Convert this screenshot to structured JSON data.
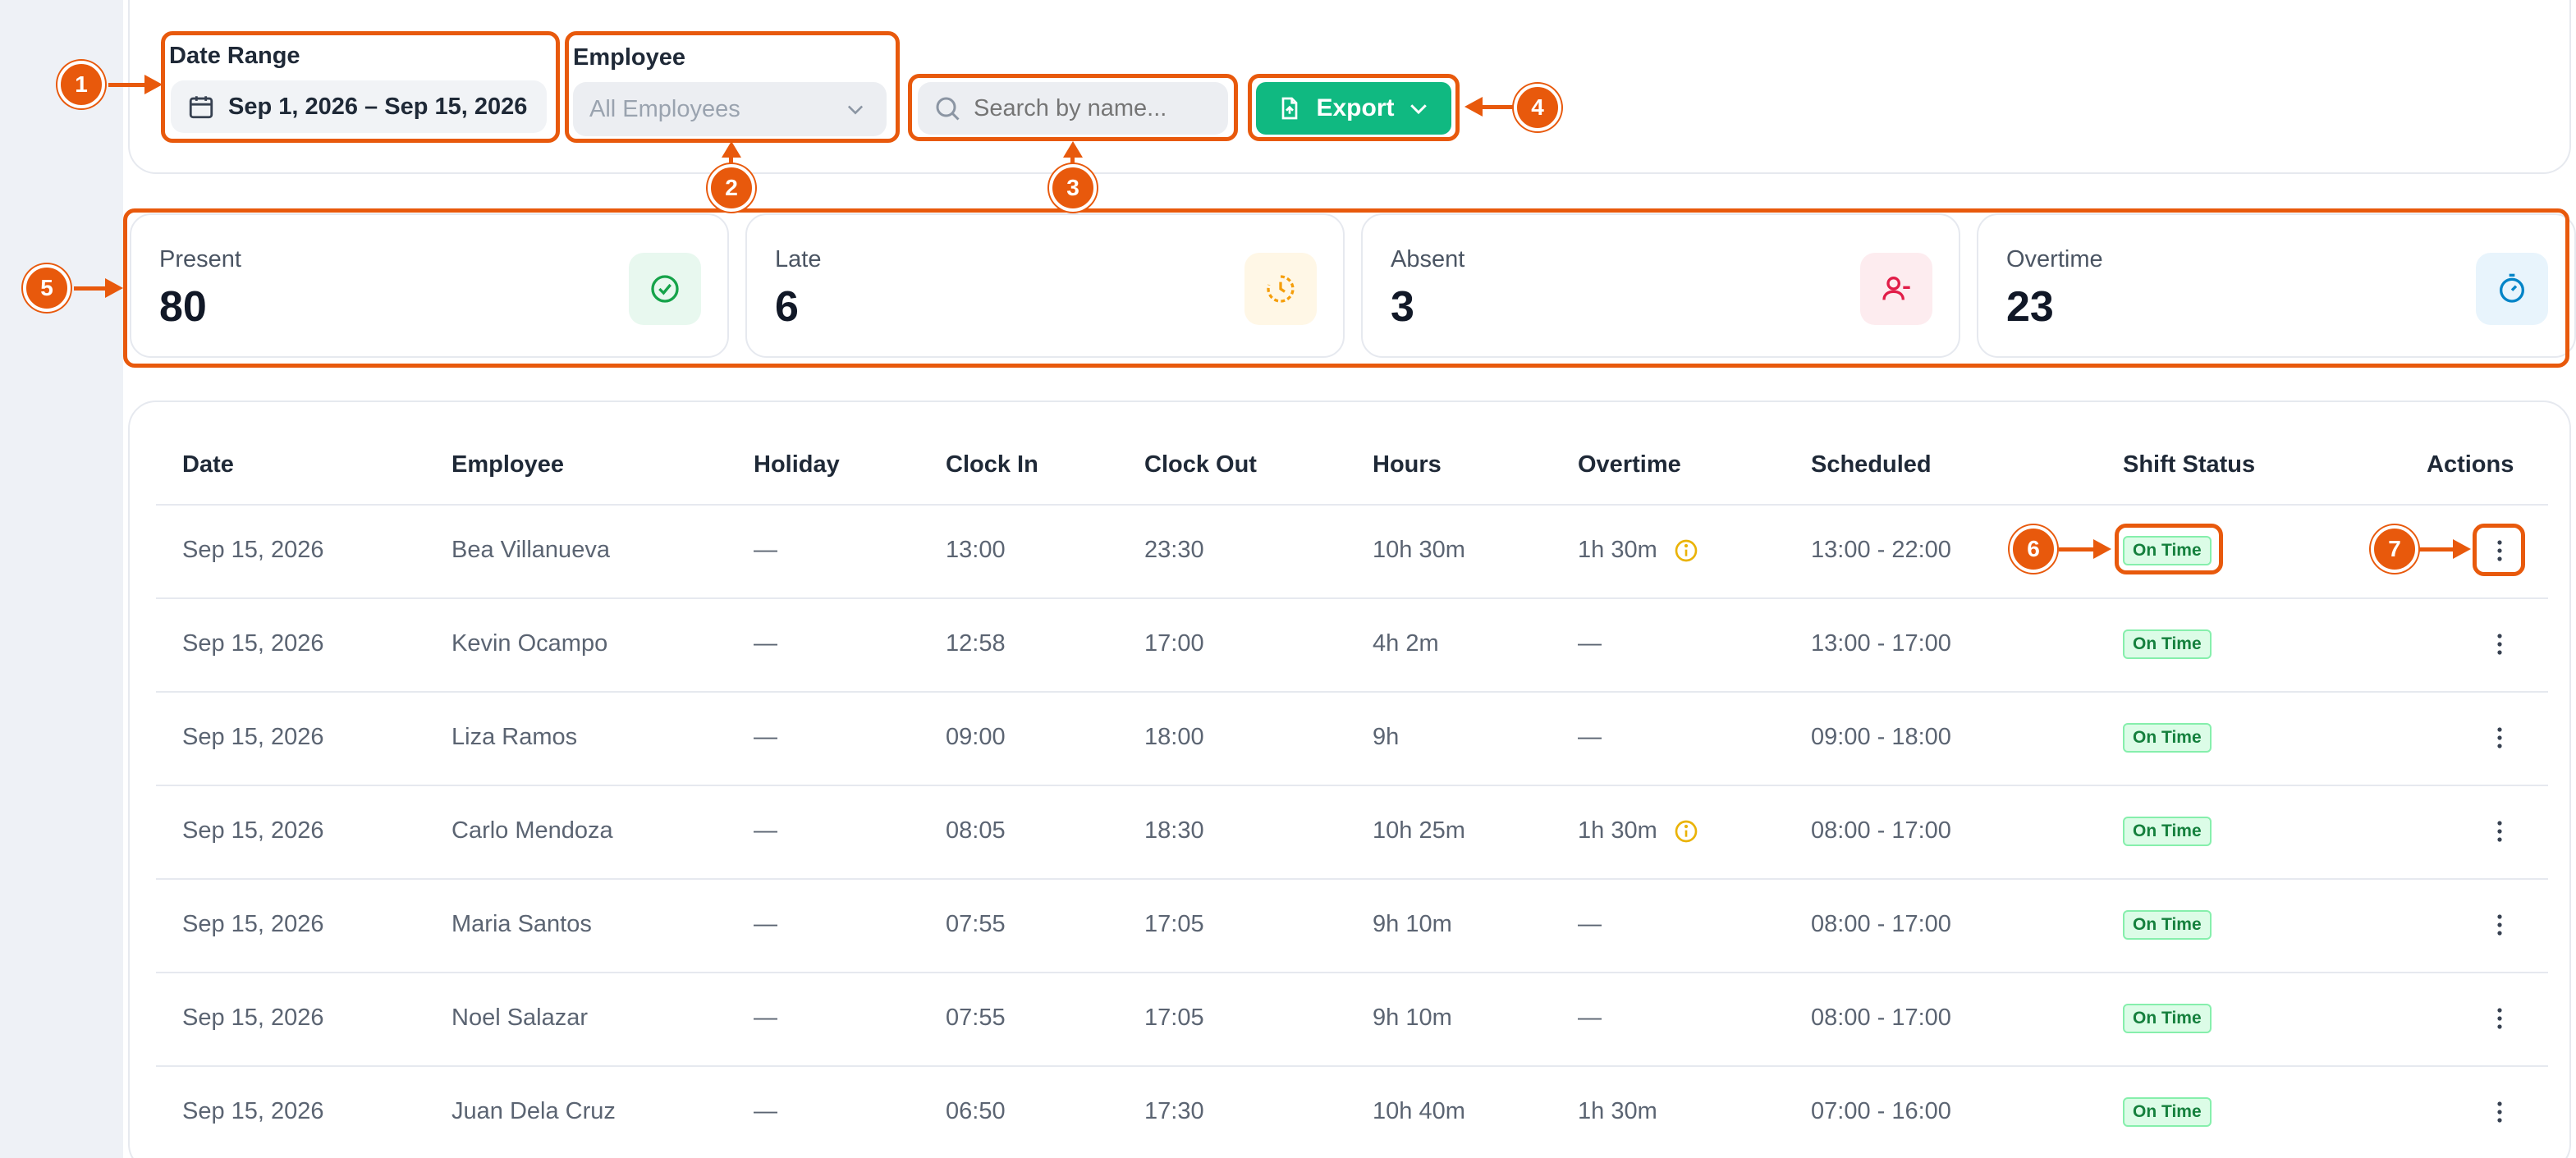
{
  "filters": {
    "date_range_label": "Date Range",
    "date_range_value": "Sep 1, 2026 – Sep 15, 2026",
    "employee_label": "Employee",
    "employee_placeholder": "All Employees",
    "search_placeholder": "Search by name...",
    "export_label": "Export"
  },
  "stats": [
    {
      "label": "Present",
      "value": "80",
      "icon": "check-circle-icon",
      "bg": "#e8f8ef",
      "fg": "#16a34a"
    },
    {
      "label": "Late",
      "value": "6",
      "icon": "clock-late-icon",
      "bg": "#fff7e6",
      "fg": "#f59e0b"
    },
    {
      "label": "Absent",
      "value": "3",
      "icon": "user-minus-icon",
      "bg": "#fdecef",
      "fg": "#e11d48"
    },
    {
      "label": "Overtime",
      "value": "23",
      "icon": "stopwatch-icon",
      "bg": "#e8f4fc",
      "fg": "#0284c7"
    }
  ],
  "table": {
    "headers": [
      "Date",
      "Employee",
      "Holiday",
      "Clock In",
      "Clock Out",
      "Hours",
      "Overtime",
      "Scheduled",
      "Shift Status",
      "Actions"
    ],
    "rows": [
      {
        "date": "Sep 15, 2026",
        "employee": "Bea Villanueva",
        "holiday": "—",
        "clock_in": "13:00",
        "clock_out": "23:30",
        "hours": "10h 30m",
        "overtime": "1h 30m",
        "ot_info": true,
        "scheduled": "13:00 - 22:00",
        "status": "On Time"
      },
      {
        "date": "Sep 15, 2026",
        "employee": "Kevin Ocampo",
        "holiday": "—",
        "clock_in": "12:58",
        "clock_out": "17:00",
        "hours": "4h 2m",
        "overtime": "—",
        "ot_info": false,
        "scheduled": "13:00 - 17:00",
        "status": "On Time"
      },
      {
        "date": "Sep 15, 2026",
        "employee": "Liza Ramos",
        "holiday": "—",
        "clock_in": "09:00",
        "clock_out": "18:00",
        "hours": "9h",
        "overtime": "—",
        "ot_info": false,
        "scheduled": "09:00 - 18:00",
        "status": "On Time"
      },
      {
        "date": "Sep 15, 2026",
        "employee": "Carlo Mendoza",
        "holiday": "—",
        "clock_in": "08:05",
        "clock_out": "18:30",
        "hours": "10h 25m",
        "overtime": "1h 30m",
        "ot_info": true,
        "scheduled": "08:00 - 17:00",
        "status": "On Time"
      },
      {
        "date": "Sep 15, 2026",
        "employee": "Maria Santos",
        "holiday": "—",
        "clock_in": "07:55",
        "clock_out": "17:05",
        "hours": "9h 10m",
        "overtime": "—",
        "ot_info": false,
        "scheduled": "08:00 - 17:00",
        "status": "On Time"
      },
      {
        "date": "Sep 15, 2026",
        "employee": "Noel Salazar",
        "holiday": "—",
        "clock_in": "07:55",
        "clock_out": "17:05",
        "hours": "9h 10m",
        "overtime": "—",
        "ot_info": false,
        "scheduled": "08:00 - 17:00",
        "status": "On Time"
      },
      {
        "date": "Sep 15, 2026",
        "employee": "Juan Dela Cruz",
        "holiday": "—",
        "clock_in": "06:50",
        "clock_out": "17:30",
        "hours": "10h 40m",
        "overtime": "1h 30m",
        "ot_info": false,
        "scheduled": "07:00 - 16:00",
        "status": "On Time"
      }
    ]
  },
  "callouts": [
    "1",
    "2",
    "3",
    "4",
    "5",
    "6",
    "7"
  ],
  "colors": {
    "accent": "#e8590c",
    "export": "#10b981",
    "status_bg": "#dcfce7",
    "status_fg": "#15803d"
  }
}
